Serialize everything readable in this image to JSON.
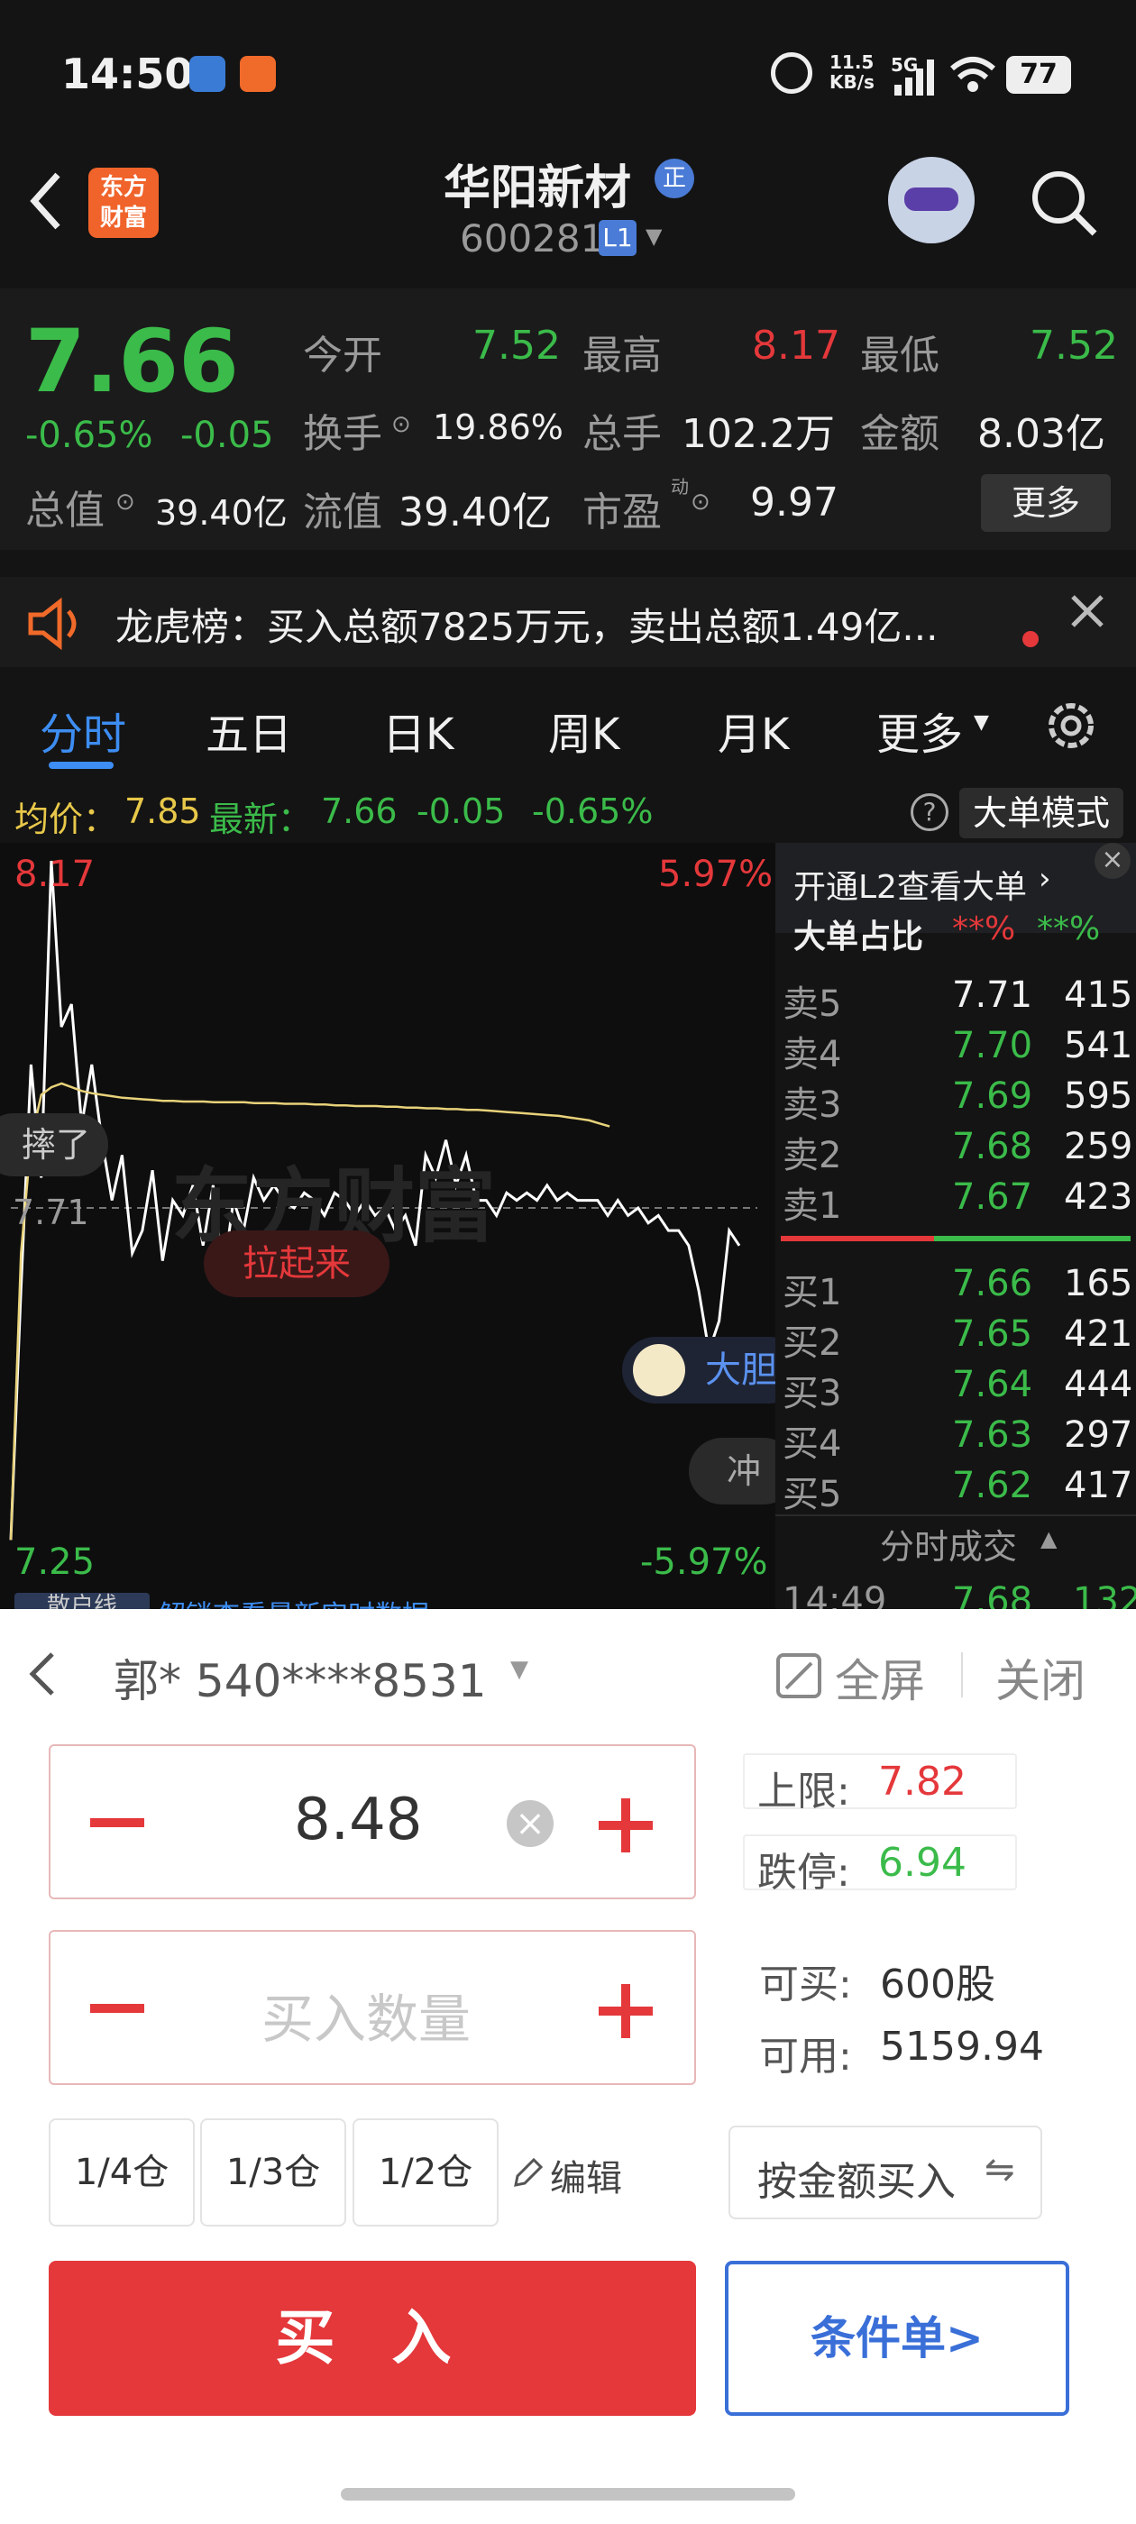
{
  "status_bar": {
    "time": "14:50",
    "net_speed": "11.5",
    "net_unit": "KB/s",
    "signal": "5G",
    "battery": "77"
  },
  "header": {
    "brand_line1": "东方",
    "brand_line2": "财富",
    "stock_name": "华阳新材",
    "badge": "正",
    "code": "600281",
    "level": "L1"
  },
  "quote": {
    "price": "7.66",
    "change_pct": "-0.65%",
    "change": "-0.05",
    "open_label": "今开",
    "open": "7.52",
    "high_label": "最高",
    "high": "8.17",
    "low_label": "最低",
    "low": "7.52",
    "turnover_label": "换手",
    "turnover": "19.86%",
    "volume_label": "总手",
    "volume": "102.2万",
    "amount_label": "金额",
    "amount": "8.03亿",
    "total_value_label": "总值",
    "total_value": "39.40亿",
    "float_value_label": "流值",
    "float_value": "39.40亿",
    "pe_label": "市盈",
    "pe_sup": "动",
    "pe": "9.97",
    "more_button": "更多"
  },
  "notice": {
    "text": "龙虎榜：买入总额7825万元，卖出总额1.49亿..."
  },
  "tabs": [
    {
      "label": "分时",
      "active": true
    },
    {
      "label": "五日"
    },
    {
      "label": "日K"
    },
    {
      "label": "周K"
    },
    {
      "label": "月K"
    },
    {
      "label": "更多"
    }
  ],
  "info_bar": {
    "avg_label": "均价：",
    "avg": "7.85",
    "latest_label": "最新：",
    "latest": "7.66",
    "change": "-0.05",
    "change_pct": "-0.65%",
    "mode_button": "大单模式"
  },
  "chart": {
    "y_high": "8.17",
    "y_low": "7.25",
    "pct_high": "5.97%",
    "pct_low": "-5.97%",
    "ref_price": "7.71",
    "annotations": [
      "拉起来",
      "摔了",
      "大胆",
      "冲"
    ],
    "watermark": "东方财富",
    "footer_label": "散户线",
    "footer_text": "解锁查看最新实时数据",
    "colors": {
      "price_line": "#ffffff",
      "avg_line": "#e8d27a",
      "bg": "#0e0e0e"
    }
  },
  "chart_data": {
    "type": "line",
    "title": "",
    "ylim": [
      7.25,
      8.17
    ],
    "ref_value": 7.71,
    "series": [
      {
        "values": [
          7.27,
          7.6,
          7.9,
          7.75,
          8.17,
          7.95,
          7.98,
          7.82,
          7.9,
          7.8,
          7.72,
          7.78,
          7.65,
          7.68,
          7.76,
          7.64,
          7.72,
          7.7,
          7.74,
          7.66,
          7.74,
          7.62,
          7.72,
          7.68,
          7.75,
          7.72,
          7.74,
          7.72,
          7.71,
          7.73,
          7.72,
          7.7,
          7.73,
          7.72,
          7.7,
          7.72,
          7.7,
          7.71,
          7.68,
          7.7,
          7.66,
          7.78,
          7.75,
          7.8,
          7.74,
          7.78,
          7.72,
          7.72,
          7.7,
          7.73,
          7.72,
          7.73,
          7.72,
          7.74,
          7.72,
          7.73,
          7.72,
          7.72,
          7.72,
          7.7,
          7.72,
          7.7,
          7.71,
          7.69,
          7.7,
          7.68,
          7.68,
          7.66,
          7.6,
          7.52,
          7.56,
          7.68,
          7.66
        ]
      },
      {
        "values": [
          7.27,
          7.65,
          7.8,
          7.86,
          7.87,
          7.875,
          7.87,
          7.865,
          7.862,
          7.86,
          7.858,
          7.856,
          7.855,
          7.854,
          7.853,
          7.852,
          7.852,
          7.851,
          7.851,
          7.851,
          7.85,
          7.85,
          7.85,
          7.85,
          7.849,
          7.849,
          7.849,
          7.848,
          7.848,
          7.848,
          7.847,
          7.847,
          7.846,
          7.846,
          7.845,
          7.845,
          7.845,
          7.844,
          7.844,
          7.843,
          7.843,
          7.842,
          7.842,
          7.841,
          7.841,
          7.84,
          7.84,
          7.839,
          7.838,
          7.837,
          7.836,
          7.835,
          7.834,
          7.833,
          7.832,
          7.83,
          7.828,
          7.826,
          7.822,
          7.818
        ]
      }
    ]
  },
  "orderbook": {
    "header": "开通L2查看大单",
    "big_ratio_label": "大单占比",
    "big_ratio_buy": "**%",
    "big_ratio_sell": "**%",
    "asks": [
      {
        "label": "卖5",
        "price": "7.71",
        "vol": "415"
      },
      {
        "label": "卖4",
        "price": "7.70",
        "vol": "541"
      },
      {
        "label": "卖3",
        "price": "7.69",
        "vol": "595"
      },
      {
        "label": "卖2",
        "price": "7.68",
        "vol": "259"
      },
      {
        "label": "卖1",
        "price": "7.67",
        "vol": "423"
      }
    ],
    "bids": [
      {
        "label": "买1",
        "price": "7.66",
        "vol": "165"
      },
      {
        "label": "买2",
        "price": "7.65",
        "vol": "421"
      },
      {
        "label": "买3",
        "price": "7.64",
        "vol": "444"
      },
      {
        "label": "买4",
        "price": "7.63",
        "vol": "297"
      },
      {
        "label": "买5",
        "price": "7.62",
        "vol": "417"
      }
    ],
    "ticks_label": "分时成交",
    "last_tick": {
      "time": "14:49",
      "price": "7.68",
      "vol": "132"
    }
  },
  "trade": {
    "account": "郭* 540****8531",
    "fullscreen": "全屏",
    "close": "关闭",
    "price_value": "8.48",
    "qty_placeholder": "买入数量",
    "upper_label": "上限:",
    "upper": "7.82",
    "limit_down_label": "跌停:",
    "limit_down": "6.94",
    "can_buy_label": "可买:",
    "can_buy": "600股",
    "available_label": "可用:",
    "available": "5159.94",
    "pos_quarter": "1/4仓",
    "pos_third": "1/3仓",
    "pos_half": "1/2仓",
    "edit": "编辑",
    "by_amount": "按金额买入",
    "buy_button": "买 入",
    "condition_button": "条件单>"
  }
}
